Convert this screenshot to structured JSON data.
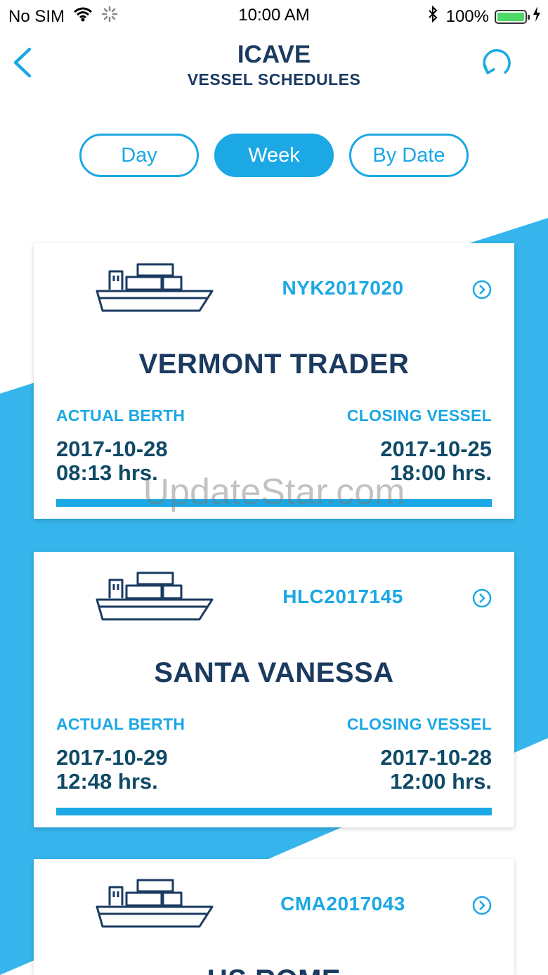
{
  "status_bar": {
    "carrier": "No SIM",
    "time": "10:00 AM",
    "battery": "100%",
    "icons": [
      "wifi-icon",
      "activity-spinner-icon",
      "bluetooth-icon",
      "battery-icon",
      "charging-bolt-icon"
    ]
  },
  "nav": {
    "title": "ICAVE",
    "subtitle": "VESSEL SCHEDULES",
    "back_icon": "chevron-left-icon",
    "refresh_icon": "refresh-icon"
  },
  "segments": [
    {
      "label": "Day",
      "active": false
    },
    {
      "label": "Week",
      "active": true
    },
    {
      "label": "By Date",
      "active": false
    }
  ],
  "colors": {
    "accent": "#1ba8e4",
    "title_navy": "#1a3a60",
    "value_teal": "#0f4a66",
    "stripe": "#35b5ec"
  },
  "vessels": [
    {
      "code": "NYK2017020",
      "name": "VERMONT TRADER",
      "berth_label": "ACTUAL BERTH",
      "berth_date": "2017-10-28",
      "berth_time": "08:13 hrs.",
      "closing_label": "CLOSING VESSEL",
      "closing_date": "2017-10-25",
      "closing_time": "18:00 hrs."
    },
    {
      "code": "HLC2017145",
      "name": "SANTA VANESSA",
      "berth_label": "ACTUAL BERTH",
      "berth_date": "2017-10-29",
      "berth_time": "12:48 hrs.",
      "closing_label": "CLOSING VESSEL",
      "closing_date": "2017-10-28",
      "closing_time": "12:00 hrs."
    },
    {
      "code": "CMA2017043",
      "name": "US ROME"
    }
  ],
  "watermark": "UpdateStar.com"
}
